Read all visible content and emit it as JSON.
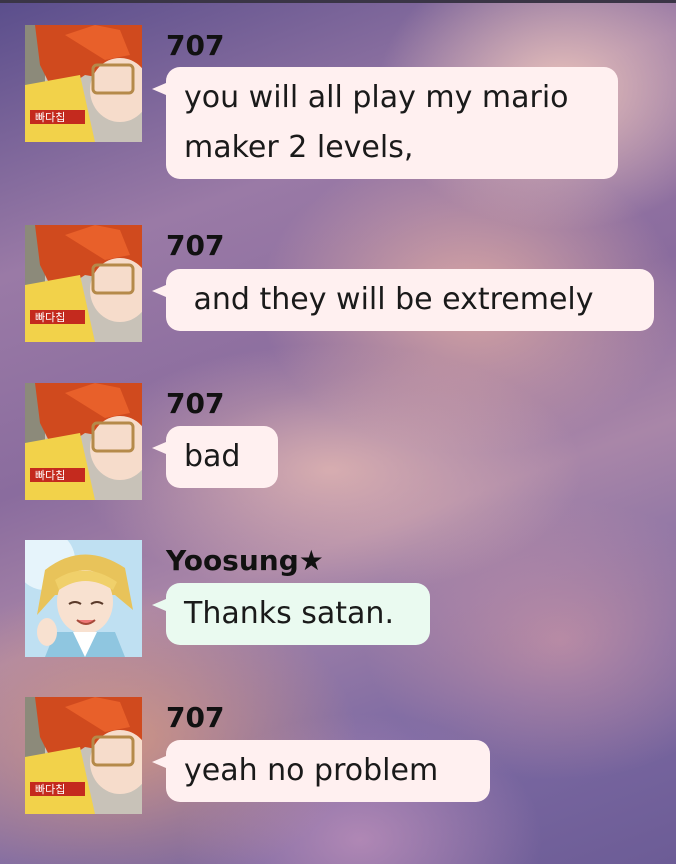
{
  "messages": [
    {
      "sender": "707",
      "text_lines": [
        "you will all play my mario",
        "maker 2 levels,"
      ],
      "avatar": "saeyoung-avatar",
      "bubble_color": "#fff0f0"
    },
    {
      "sender": "707",
      "text_lines": [
        " and they will be extremely"
      ],
      "avatar": "saeyoung-avatar",
      "bubble_color": "#fff0f0"
    },
    {
      "sender": "707",
      "text_lines": [
        "bad"
      ],
      "avatar": "saeyoung-avatar",
      "bubble_color": "#fff0f0"
    },
    {
      "sender": "Yoosung★",
      "text_lines": [
        "Thanks satan."
      ],
      "avatar": "yoosung-avatar",
      "bubble_color": "#eafaf0"
    },
    {
      "sender": "707",
      "text_lines": [
        "yeah no problem"
      ],
      "avatar": "saeyoung-avatar",
      "bubble_color": "#fff0f0"
    }
  ]
}
